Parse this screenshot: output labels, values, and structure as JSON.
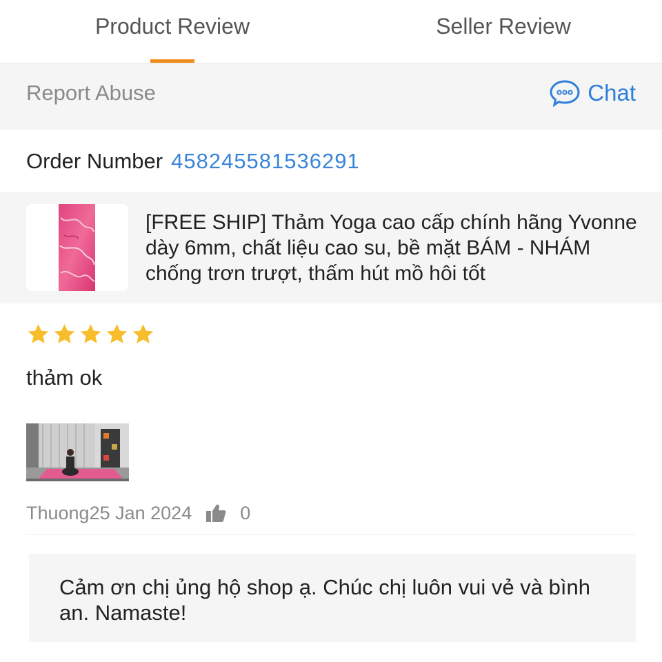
{
  "tabs": {
    "product_review": "Product Review",
    "seller_review": "Seller Review",
    "active": "product_review"
  },
  "toolbar": {
    "report_abuse": "Report Abuse",
    "chat": "Chat",
    "chat_icon": "chat-bubble-icon"
  },
  "order": {
    "label": "Order Number",
    "number": "458245581536291"
  },
  "product": {
    "title": "[FREE SHIP] Thảm Yoga cao cấp chính hãng Yvonne dày 6mm, chất liệu cao su, bề mặt BÁM - NHÁM chống trơn trượt, thấm hút mồ hôi tốt",
    "thumbnail": "pink-yoga-mat-image"
  },
  "review": {
    "rating": 5,
    "max_rating": 5,
    "text": "thảm ok",
    "photo": "yoga-photo-image",
    "author_date": "Thuong25 Jan 2024",
    "likes": "0"
  },
  "seller_reply": {
    "text": "Cảm ơn chị ủng hộ shop ạ. Chúc chị luôn vui vẻ và bình an. Namaste!"
  },
  "colors": {
    "accent": "#f08c1b",
    "link": "#3a85d6",
    "star": "#f7bd2c",
    "muted": "#8a8a8a",
    "panel": "#f5f5f5"
  }
}
